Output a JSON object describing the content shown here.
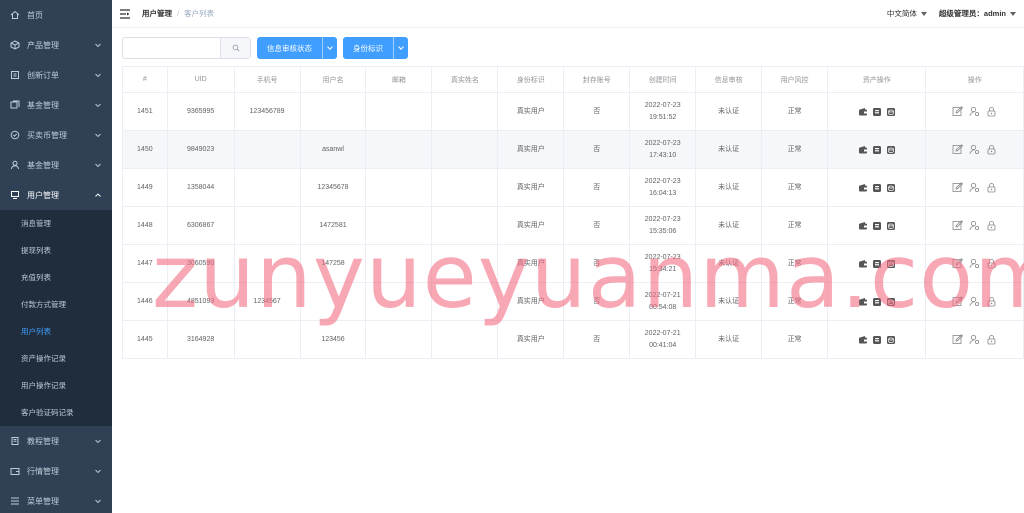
{
  "sidebar": {
    "items": [
      {
        "label": "首页",
        "icon": "home-icon",
        "expandable": false
      },
      {
        "label": "产品管理",
        "icon": "box-icon",
        "expandable": true
      },
      {
        "label": "创新订单",
        "icon": "order-icon",
        "expandable": true
      },
      {
        "label": "基金管理",
        "icon": "fund-icon",
        "expandable": true
      },
      {
        "label": "买卖币管理",
        "icon": "coin-icon",
        "expandable": true
      },
      {
        "label": "基金管理",
        "icon": "fund-user-icon",
        "expandable": true
      },
      {
        "label": "用户管理",
        "icon": "monitor-icon",
        "expandable": true,
        "open": true
      }
    ],
    "sub_items": [
      "消息管理",
      "提现列表",
      "充值列表",
      "付款方式管理",
      "用户列表",
      "资产操作记录",
      "用户操作记录",
      "客户验证码记录"
    ],
    "active_sub": 4,
    "bottom_items": [
      {
        "label": "教程管理",
        "icon": "book-icon"
      },
      {
        "label": "行情管理",
        "icon": "wallet-icon"
      },
      {
        "label": "菜单管理",
        "icon": "menu-list-icon"
      }
    ]
  },
  "navbar": {
    "breadcrumb": [
      "用户管理",
      "客户列表"
    ],
    "language": "中文简体",
    "user": "超级管理员：admin"
  },
  "toolbar": {
    "search_placeholder": "",
    "filter_button": "信息审核状态",
    "identity_button": "身份标识"
  },
  "colors": {
    "accent": "#409eff",
    "sidebar": "#304156",
    "submenu": "#1f2d3d"
  },
  "table": {
    "headers": [
      "#",
      "UID",
      "手机号",
      "用户名",
      "邮箱",
      "真实姓名",
      "身份标识",
      "封存账号",
      "创建时间",
      "信息审核",
      "用户风控",
      "资产操作",
      "操作"
    ],
    "rows": [
      [
        "1451",
        "9365995",
        "123456789",
        "",
        "",
        "",
        "真实用户",
        "否",
        "2022-07-23 19:51:52",
        "未认证",
        "正常"
      ],
      [
        "1450",
        "9849023",
        "",
        "asanwl",
        "",
        "",
        "真实用户",
        "否",
        "2022-07-23 17:43:10",
        "未认证",
        "正常"
      ],
      [
        "1449",
        "1358044",
        "",
        "12345678",
        "",
        "",
        "真实用户",
        "否",
        "2022-07-23 16:04:13",
        "未认证",
        "正常"
      ],
      [
        "1448",
        "6306867",
        "",
        "1472581",
        "",
        "",
        "真实用户",
        "否",
        "2022-07-23 15:35:06",
        "未认证",
        "正常"
      ],
      [
        "1447",
        "3060590",
        "",
        "147258",
        "",
        "",
        "真实用户",
        "否",
        "2022-07-23 15:34:21",
        "未认证",
        "正常"
      ],
      [
        "1446",
        "4851093",
        "1234567",
        "",
        "",
        "",
        "真实用户",
        "否",
        "2022-07-21 00:54:08",
        "未认证",
        "正常"
      ],
      [
        "1445",
        "3164928",
        "",
        "123456",
        "",
        "",
        "真实用户",
        "否",
        "2022-07-21 00:41:04",
        "未认证",
        "正常"
      ]
    ],
    "highlight_row": 1
  },
  "watermark": "zunyueyuanma.com"
}
